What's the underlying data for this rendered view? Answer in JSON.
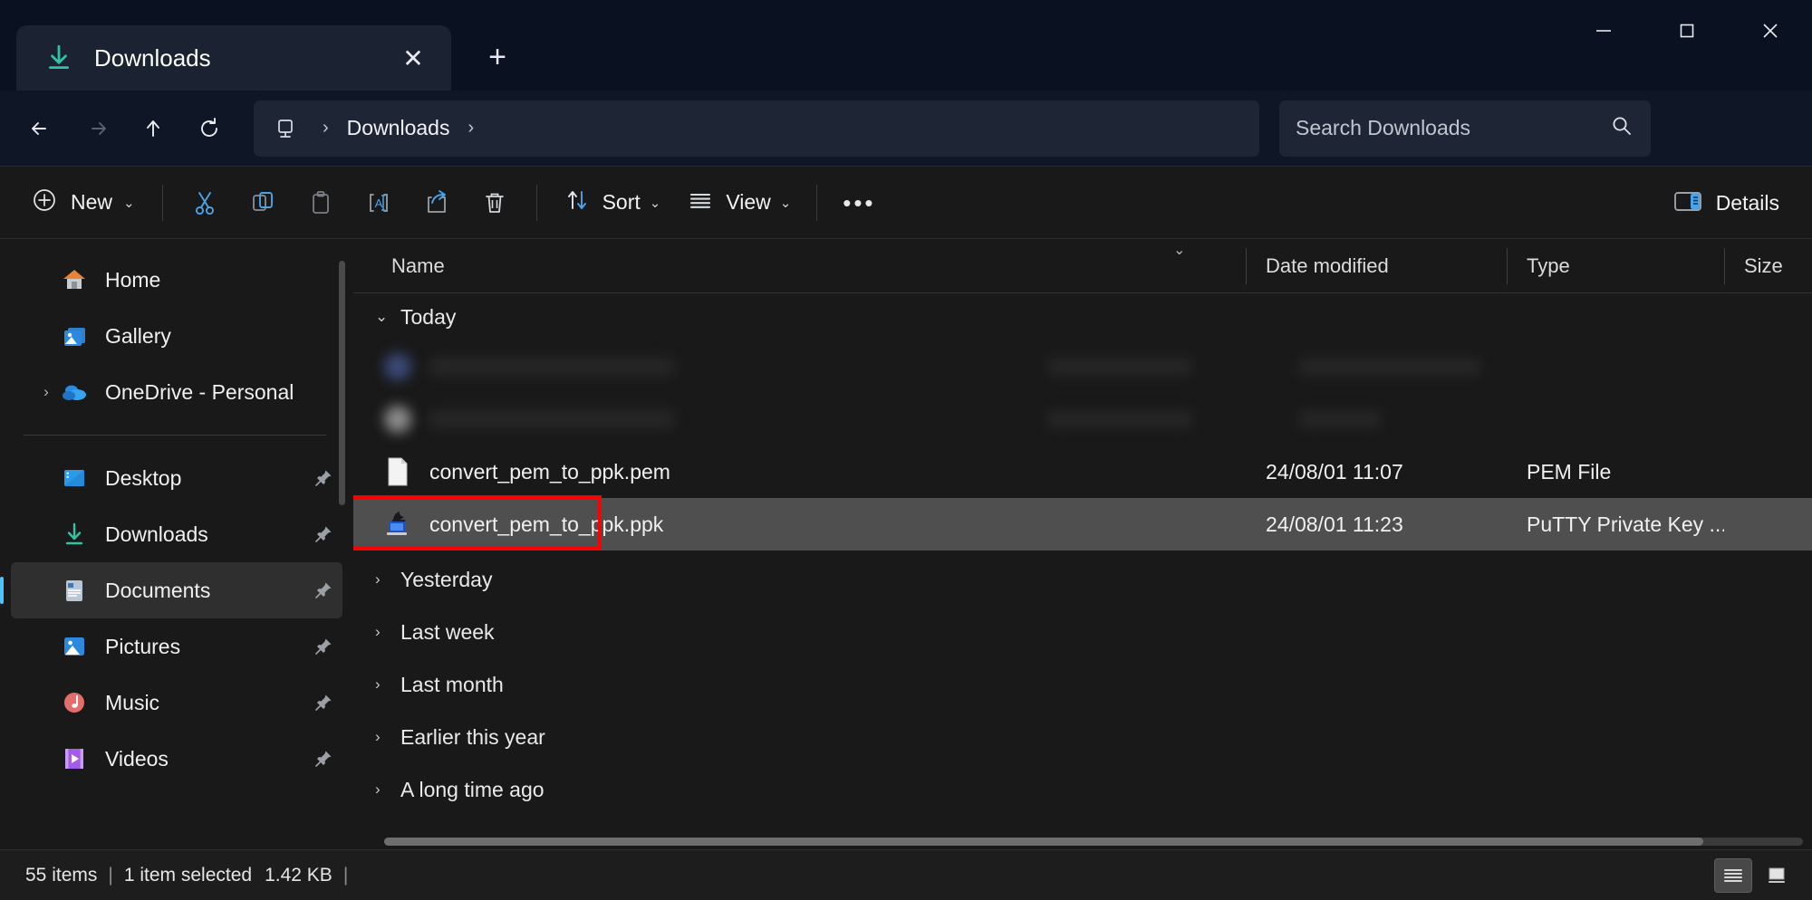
{
  "window": {
    "title": "Downloads",
    "controls": {
      "minimize": "minimize-icon",
      "maximize": "maximize-icon",
      "close": "close-icon"
    }
  },
  "tabs": {
    "items": [
      {
        "label": "Downloads",
        "icon": "downloads-icon"
      }
    ],
    "new_tab_label": "+",
    "close_label": "✕"
  },
  "nav": {
    "back": "back-arrow-icon",
    "forward": "forward-arrow-icon",
    "up": "up-arrow-icon",
    "refresh": "refresh-icon"
  },
  "breadcrumb": {
    "root_icon": "this-pc-icon",
    "separator": "›",
    "path": "Downloads",
    "trailing_separator": "›"
  },
  "search": {
    "placeholder": "Search Downloads",
    "icon": "search-icon"
  },
  "toolbar": {
    "new_label": "New",
    "new_caret": "⌄",
    "cut_label": "Cut",
    "copy_label": "Copy",
    "paste_label": "Paste",
    "rename_label": "Rename",
    "share_label": "Share",
    "delete_label": "Delete",
    "sort_label": "Sort",
    "sort_caret": "⌄",
    "view_label": "View",
    "view_caret": "⌄",
    "more_label": "•••",
    "details_label": "Details"
  },
  "sidebar": {
    "items": [
      {
        "label": "Home",
        "icon": "home-icon",
        "expander": "",
        "pinned": false,
        "selected": false
      },
      {
        "label": "Gallery",
        "icon": "gallery-icon",
        "expander": "",
        "pinned": false,
        "selected": false
      },
      {
        "label": "OneDrive - Personal",
        "icon": "onedrive-icon",
        "expander": "›",
        "pinned": false,
        "selected": false
      }
    ],
    "quick_access": [
      {
        "label": "Desktop",
        "icon": "desktop-icon",
        "pinned": true,
        "selected": false
      },
      {
        "label": "Downloads",
        "icon": "downloads-icon",
        "pinned": true,
        "selected": false
      },
      {
        "label": "Documents",
        "icon": "documents-icon",
        "pinned": true,
        "selected": true
      },
      {
        "label": "Pictures",
        "icon": "pictures-icon",
        "pinned": true,
        "selected": false
      },
      {
        "label": "Music",
        "icon": "music-icon",
        "pinned": true,
        "selected": false
      },
      {
        "label": "Videos",
        "icon": "videos-icon",
        "pinned": true,
        "selected": false
      }
    ]
  },
  "filelist": {
    "columns": [
      {
        "key": "name",
        "label": "Name"
      },
      {
        "key": "date",
        "label": "Date modified"
      },
      {
        "key": "type",
        "label": "Type"
      },
      {
        "key": "size",
        "label": "Size"
      }
    ],
    "sort_indicator": "⌄",
    "groups": [
      {
        "label": "Today",
        "expanded": true,
        "caret": "⌄",
        "rows": [
          {
            "name": "",
            "date": "",
            "type": "",
            "size": "",
            "icon": "",
            "redacted": true,
            "selected": false
          },
          {
            "name": "",
            "date": "",
            "type": "",
            "size": "",
            "icon": "",
            "redacted": true,
            "selected": false
          },
          {
            "name": "convert_pem_to_ppk.pem",
            "date": "24/08/01 11:07",
            "type": "PEM File",
            "size": "",
            "icon": "generic-file-icon",
            "redacted": false,
            "selected": false
          },
          {
            "name": "convert_pem_to_ppk.ppk",
            "date": "24/08/01 11:23",
            "type": "PuTTY Private Key ...",
            "size": "",
            "icon": "putty-key-icon",
            "redacted": false,
            "selected": true,
            "highlighted": true
          }
        ]
      },
      {
        "label": "Yesterday",
        "expanded": false,
        "caret": "›",
        "rows": []
      },
      {
        "label": "Last week",
        "expanded": false,
        "caret": "›",
        "rows": []
      },
      {
        "label": "Last month",
        "expanded": false,
        "caret": "›",
        "rows": []
      },
      {
        "label": "Earlier this year",
        "expanded": false,
        "caret": "›",
        "rows": []
      },
      {
        "label": "A long time ago",
        "expanded": false,
        "caret": "›",
        "rows": []
      }
    ]
  },
  "statusbar": {
    "item_count": "55 items",
    "sep1": "|",
    "selection": "1 item selected",
    "selection_size": "1.42 KB",
    "sep2": "|",
    "details_view_label": "Details view",
    "large_icons_view_label": "Large icons view"
  },
  "colors": {
    "accent": "#4cc2ff",
    "annotation": "#ff0000",
    "titlebar_bg": "#0a1120",
    "chrome_bg": "#191919",
    "selection_bg": "#4f4f4f"
  }
}
